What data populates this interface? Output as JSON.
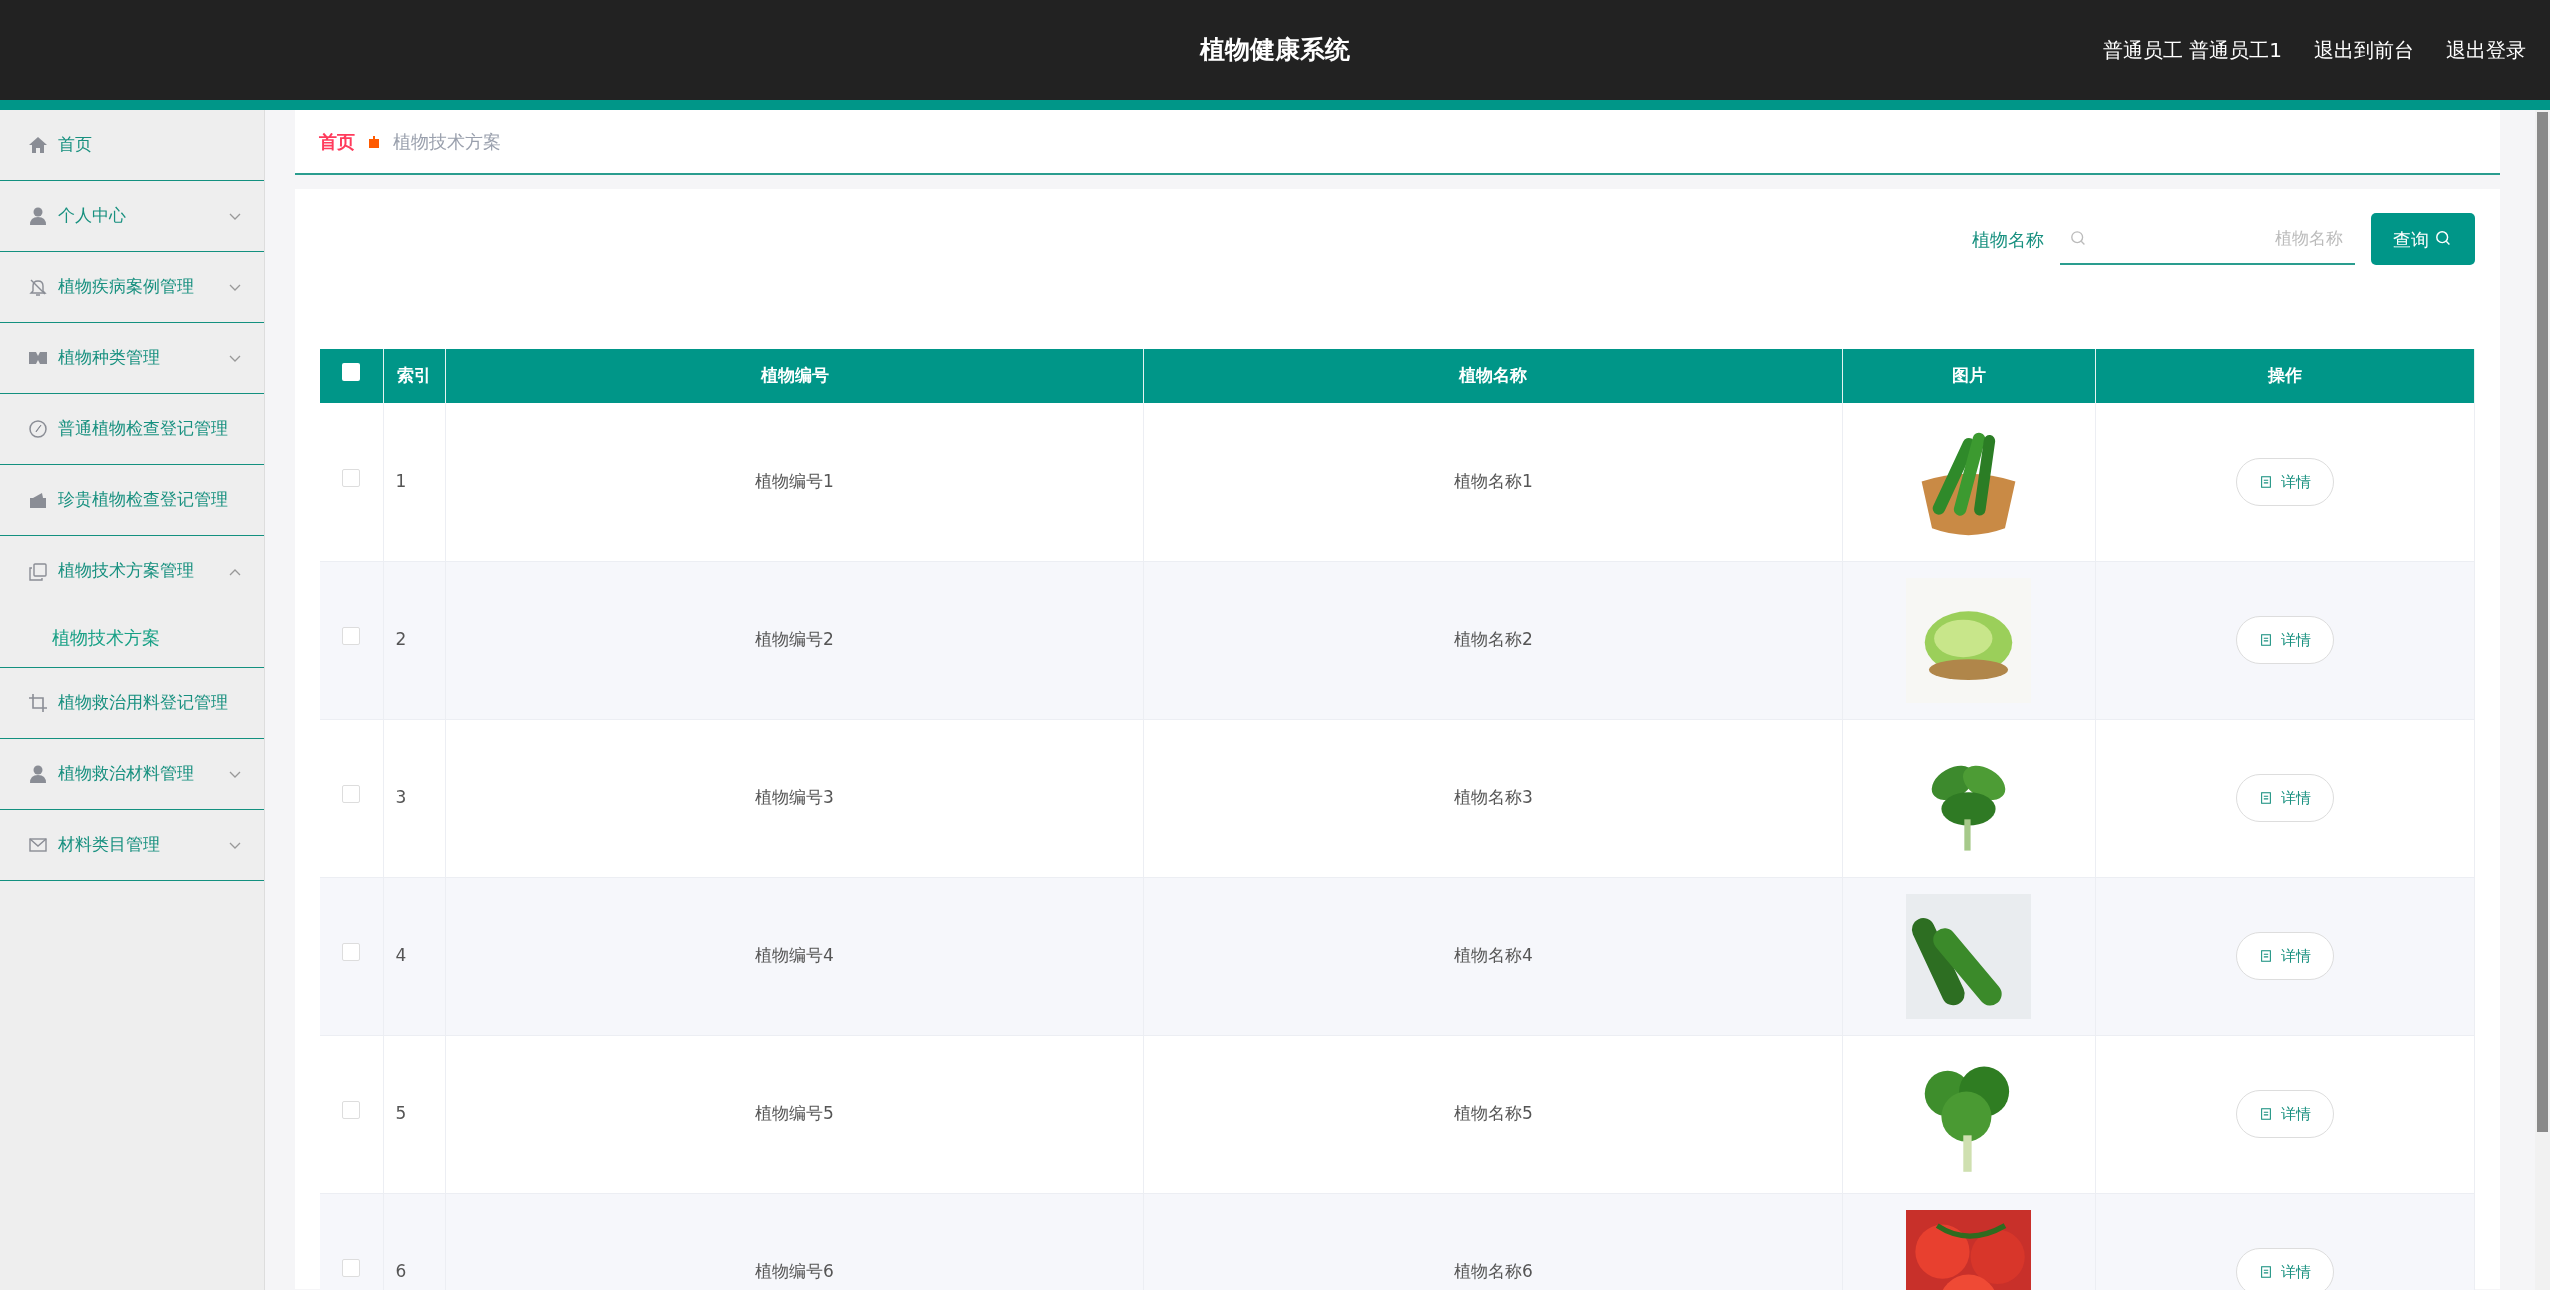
{
  "header": {
    "title": "植物健康系统",
    "user": "普通员工 普通员工1",
    "links": [
      "退出到前台",
      "退出登录"
    ]
  },
  "sidebar": {
    "items": [
      {
        "label": "首页",
        "kind": "link"
      },
      {
        "label": "个人中心",
        "kind": "menu",
        "expanded": false
      },
      {
        "label": "植物疾病案例管理",
        "kind": "menu",
        "expanded": false
      },
      {
        "label": "植物种类管理",
        "kind": "menu",
        "expanded": false
      },
      {
        "label": "普通植物检查登记管理",
        "kind": "link"
      },
      {
        "label": "珍贵植物检查登记管理",
        "kind": "link"
      },
      {
        "label": "植物技术方案管理",
        "kind": "menu",
        "expanded": true,
        "children": [
          {
            "label": "植物技术方案"
          }
        ]
      },
      {
        "label": "植物救治用料登记管理",
        "kind": "link"
      },
      {
        "label": "植物救治材料管理",
        "kind": "menu",
        "expanded": false
      },
      {
        "label": "材料类目管理",
        "kind": "menu",
        "expanded": false
      }
    ]
  },
  "breadcrumb": [
    "首页",
    "植物技术方案"
  ],
  "search": {
    "label": "植物名称",
    "placeholder": "植物名称",
    "button": "查询"
  },
  "table": {
    "all_checked": false,
    "columns": [
      "索引",
      "植物编号",
      "植物名称",
      "图片",
      "操作"
    ],
    "rows": [
      {
        "checked": false,
        "index": "1",
        "code": "植物编号1",
        "name": "植物名称1",
        "action": "详情"
      },
      {
        "checked": false,
        "index": "2",
        "code": "植物编号2",
        "name": "植物名称2",
        "action": "详情"
      },
      {
        "checked": false,
        "index": "3",
        "code": "植物编号3",
        "name": "植物名称3",
        "action": "详情"
      },
      {
        "checked": false,
        "index": "4",
        "code": "植物编号4",
        "name": "植物名称4",
        "action": "详情"
      },
      {
        "checked": false,
        "index": "5",
        "code": "植物编号5",
        "name": "植物名称5",
        "action": "详情"
      },
      {
        "checked": false,
        "index": "6",
        "code": "植物编号6",
        "name": "植物名称6",
        "action": "详情"
      }
    ]
  }
}
